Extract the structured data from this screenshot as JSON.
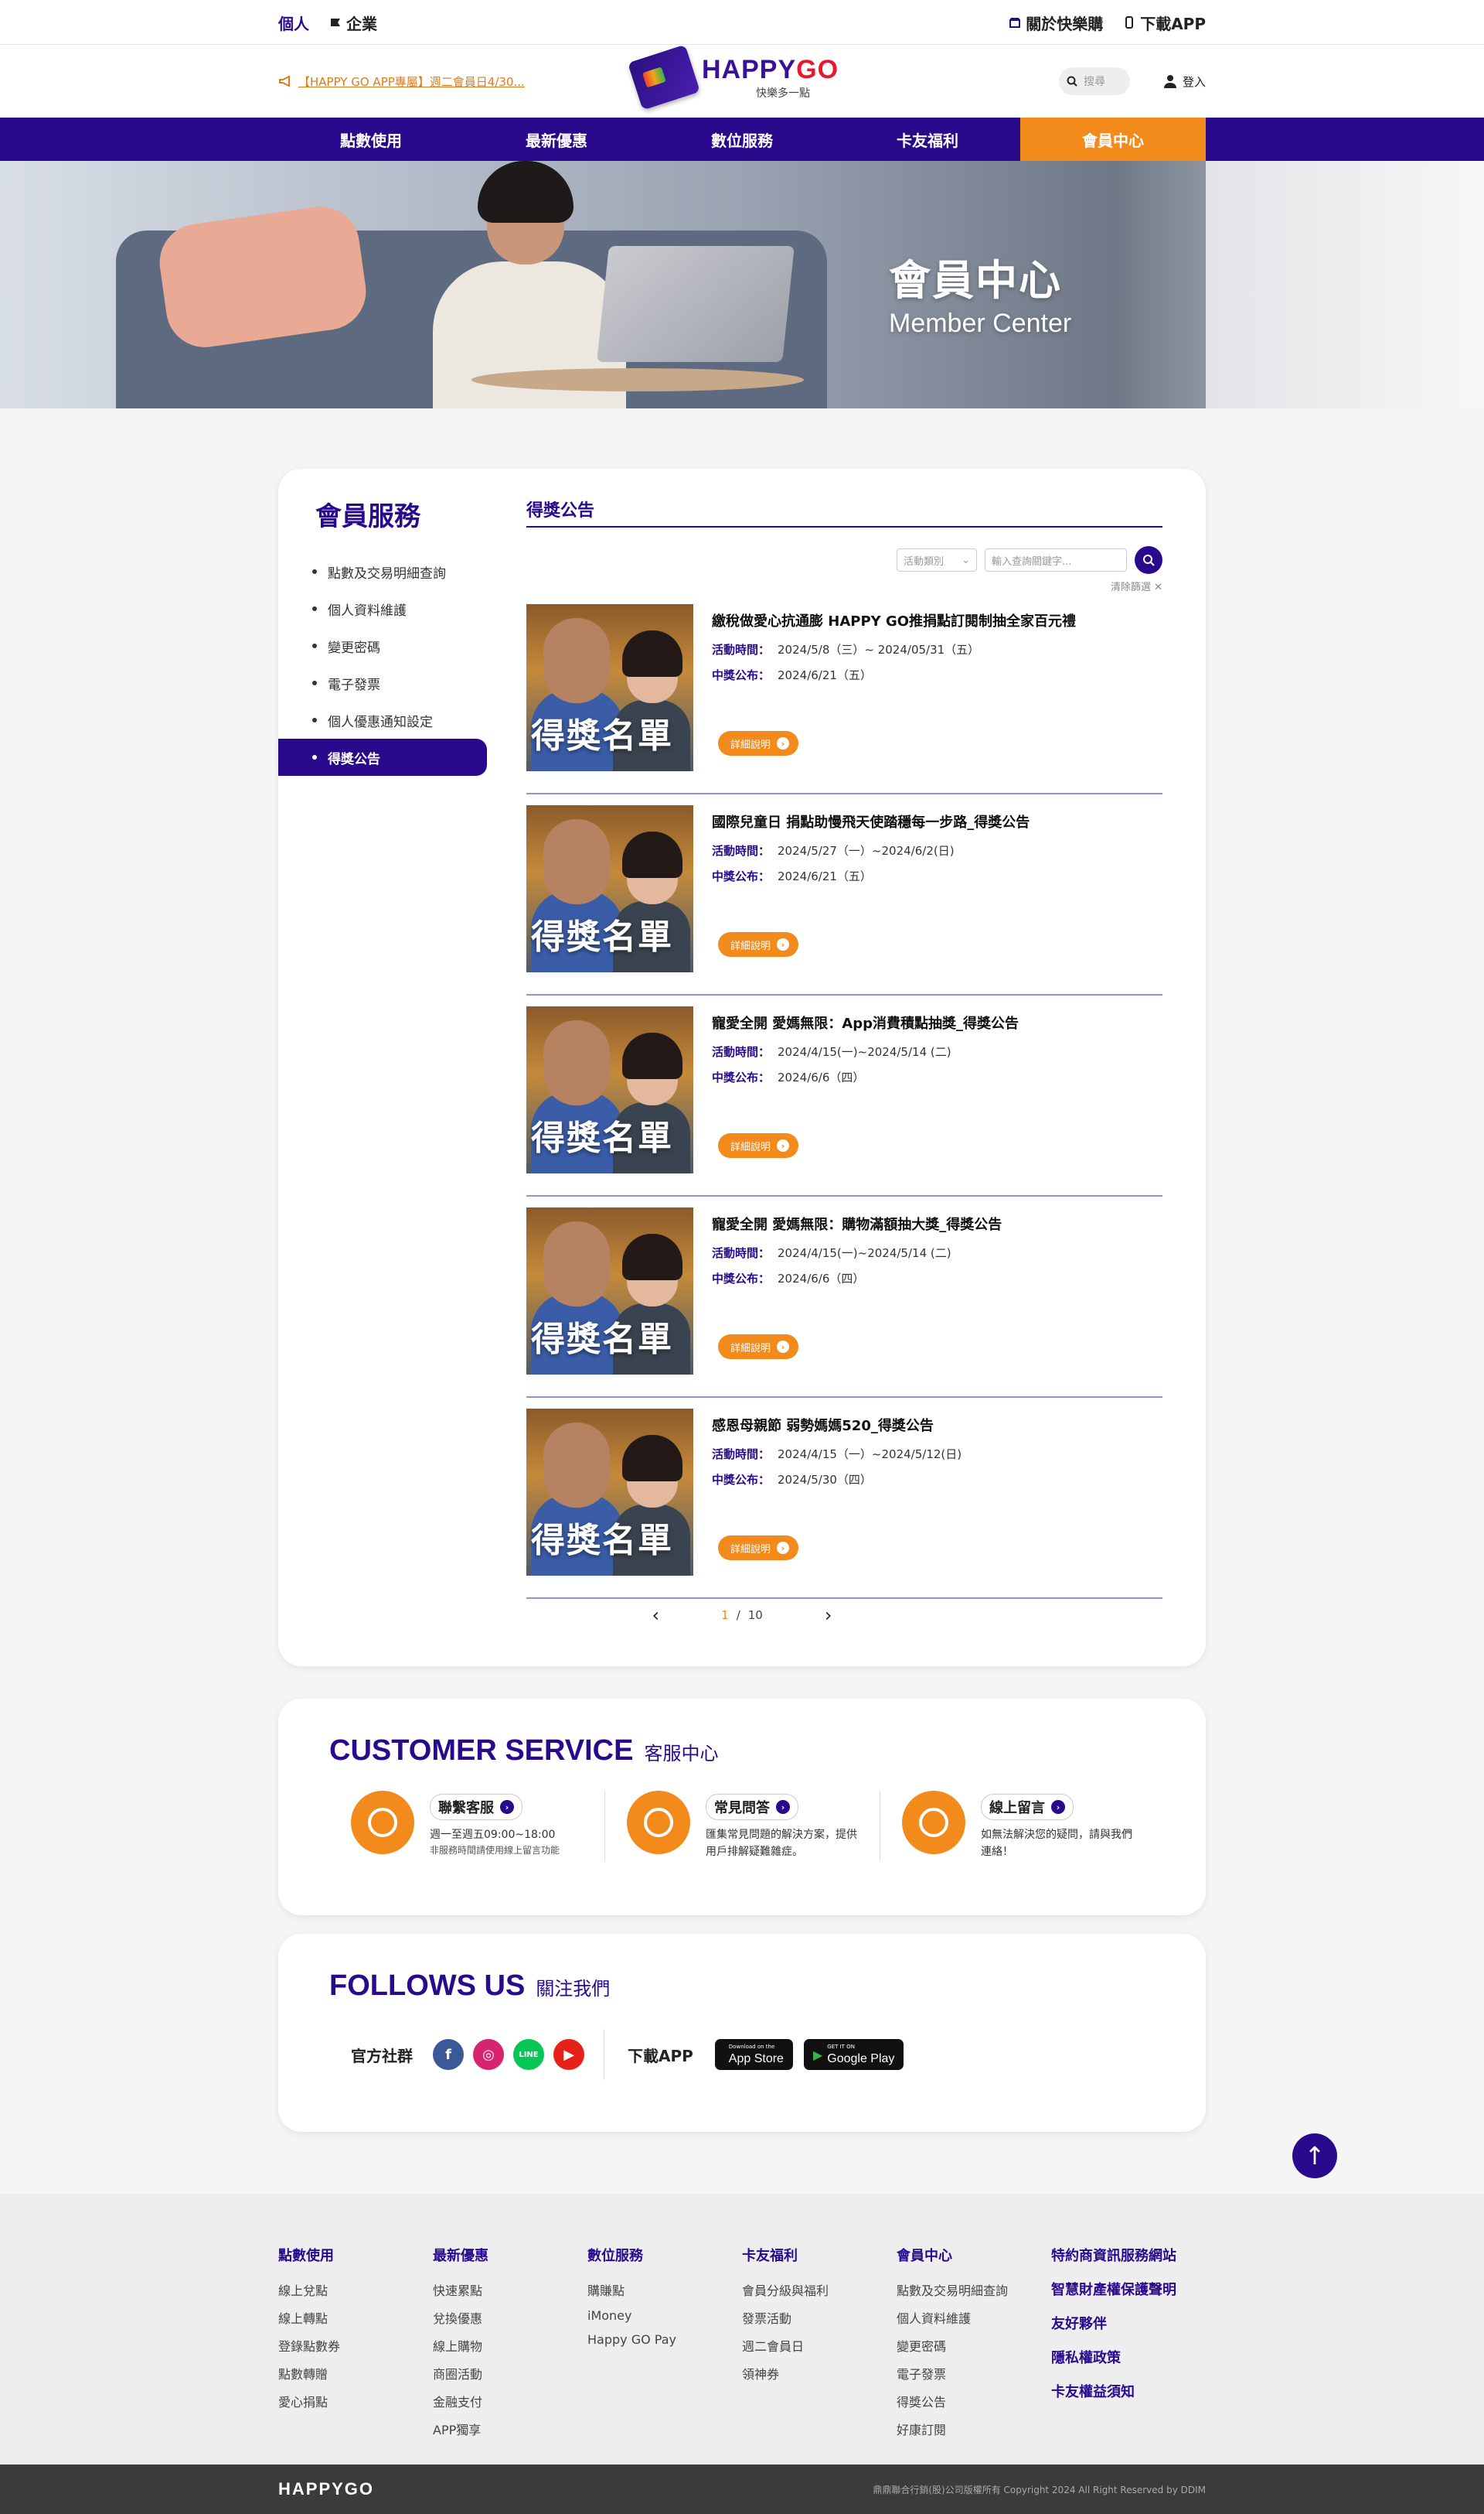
{
  "topbar": {
    "left": [
      "個人",
      "企業"
    ],
    "about": "關於快樂購",
    "download": "下載APP"
  },
  "header": {
    "marquee": "【HAPPY GO APP專屬】週二會員日4/30...",
    "logo_word1": "HAPPY",
    "logo_word2": "GO",
    "logo_slogan": "快樂多一點",
    "search_placeholder": "搜尋",
    "login": "登入"
  },
  "nav": [
    "點數使用",
    "最新優惠",
    "數位服務",
    "卡友福利",
    "會員中心"
  ],
  "banner": {
    "title": "會員中心",
    "subtitle": "Member Center"
  },
  "sidebar": {
    "title": "會員服務",
    "items": [
      "點數及交易明細查詢",
      "個人資料維護",
      "變更密碼",
      "電子發票",
      "個人優惠通知設定",
      "得獎公告"
    ]
  },
  "content": {
    "title": "得獎公告",
    "filter_select": "活動類別",
    "filter_input": "輸入查詢關鍵字...",
    "clear": "清除篩選 ✕",
    "thumb_text": "得獎名單",
    "label_time": "活動時間：",
    "label_announce": "中獎公布：",
    "detail": "詳細說明",
    "items": [
      {
        "title": "繳稅做愛心抗通膨 HAPPY GO推捐點訂閱制抽全家百元禮",
        "time": "2024/5/8（三）~ 2024/05/31（五）",
        "announce": "2024/6/21（五）"
      },
      {
        "title": "國際兒童日 捐點助慢飛天使踏穩每一步路_得獎公告",
        "time": "2024/5/27（一）~2024/6/2(日)",
        "announce": "2024/6/21（五）"
      },
      {
        "title": "寵愛全開 愛媽無限：App消費積點抽獎_得獎公告",
        "time": "2024/4/15(一)~2024/5/14 (二)",
        "announce": "2024/6/6（四）"
      },
      {
        "title": "寵愛全開 愛媽無限：購物滿額抽大獎_得獎公告",
        "time": "2024/4/15(一)~2024/5/14 (二)",
        "announce": "2024/6/6（四）"
      },
      {
        "title": "感恩母親節 弱勢媽媽520_得獎公告",
        "time": "2024/4/15（一）~2024/5/12(日)",
        "announce": "2024/5/30（四）"
      }
    ],
    "pager": {
      "current": "1",
      "sep": "/",
      "total": "10"
    }
  },
  "customer_service": {
    "title_en": "CUSTOMER SERVICE",
    "title_zh": "客服中心",
    "cols": [
      {
        "label": "聯繫客服",
        "desc": "週一至週五09:00~18:00",
        "note": "非服務時間請使用線上留言功能"
      },
      {
        "label": "常見問答",
        "desc": "匯集常見問題的解決方案，提供用戶排解疑難雜症。",
        "note": ""
      },
      {
        "label": "線上留言",
        "desc": "如無法解決您的疑問，請與我們連絡！",
        "note": ""
      }
    ]
  },
  "follows": {
    "title_en": "FOLLOWS US",
    "title_zh": "關注我們",
    "social_label": "官方社群",
    "app_label": "下載APP",
    "appstore_small": "Download on the",
    "appstore_large": "App Store",
    "gplay_small": "GET IT ON",
    "gplay_large": "Google Play",
    "social_icons": [
      "facebook-icon",
      "instagram-icon",
      "line-icon",
      "youtube-icon"
    ],
    "line_text": "LINE"
  },
  "footer": {
    "cols": [
      {
        "h": "點數使用",
        "l": [
          "線上兌點",
          "線上轉點",
          "登錄點數券",
          "點數轉贈",
          "愛心捐點"
        ]
      },
      {
        "h": "最新優惠",
        "l": [
          "快速累點",
          "兌換優惠",
          "線上購物",
          "商圈活動",
          "金融支付",
          "APP獨享"
        ]
      },
      {
        "h": "數位服務",
        "l": [
          "購賺點",
          "iMoney",
          "Happy GO Pay"
        ]
      },
      {
        "h": "卡友福利",
        "l": [
          "會員分級與福利",
          "發票活動",
          "週二會員日",
          "領神券"
        ]
      },
      {
        "h": "會員中心",
        "l": [
          "點數及交易明細查詢",
          "個人資料維護",
          "變更密碼",
          "電子發票",
          "得獎公告",
          "好康訂閱"
        ]
      }
    ],
    "links": [
      "特約商資訊服務網站",
      "智慧財產權保護聲明",
      "友好夥伴",
      "隱私權政策",
      "卡友權益須知"
    ],
    "brand": "HAPPYGO",
    "copyright": "鼎鼎聯合行銷(股)公司版權所有 Copyright 2024 All Right Reserved by DDIM"
  },
  "colors": {
    "primary": "#2a0a8c",
    "accent": "#f28a1c"
  }
}
